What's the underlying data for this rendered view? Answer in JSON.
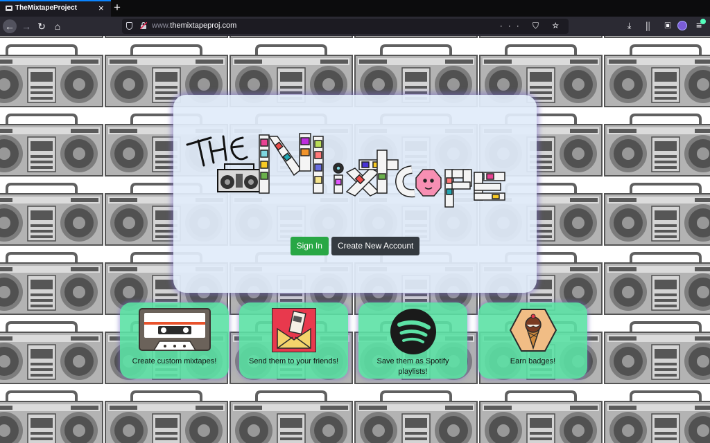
{
  "browser": {
    "tab_title": "TheMixtapeProject",
    "tab_close": "×",
    "new_tab": "+",
    "url_host": "themixtapeproj.com",
    "url_prefix": "www.",
    "url_actions": "··· ⛉ ☆",
    "back": "←",
    "forward": "→",
    "reload": "↻",
    "home": "⌂",
    "toolbar": "⤓ ⫼ ▣",
    "menu": "≡"
  },
  "hero": {
    "logo_the": "THE",
    "logo_word": "Mixtape",
    "signin_label": "Sign In",
    "create_label": "Create New Account"
  },
  "features": [
    {
      "label": "Create custom mixtapes!",
      "icon": "cassette-icon"
    },
    {
      "label": "Send them to your friends!",
      "icon": "envelope-icon"
    },
    {
      "label": "Save them as Spotify playlists!",
      "icon": "spotify-icon"
    },
    {
      "label": "Earn badges!",
      "icon": "ice-cream-badge-icon"
    }
  ],
  "colors": {
    "signin": "#28a745",
    "create": "#343a40",
    "feature_bg": "#5ce1a5",
    "hero_bg": "#e1ecfa"
  }
}
